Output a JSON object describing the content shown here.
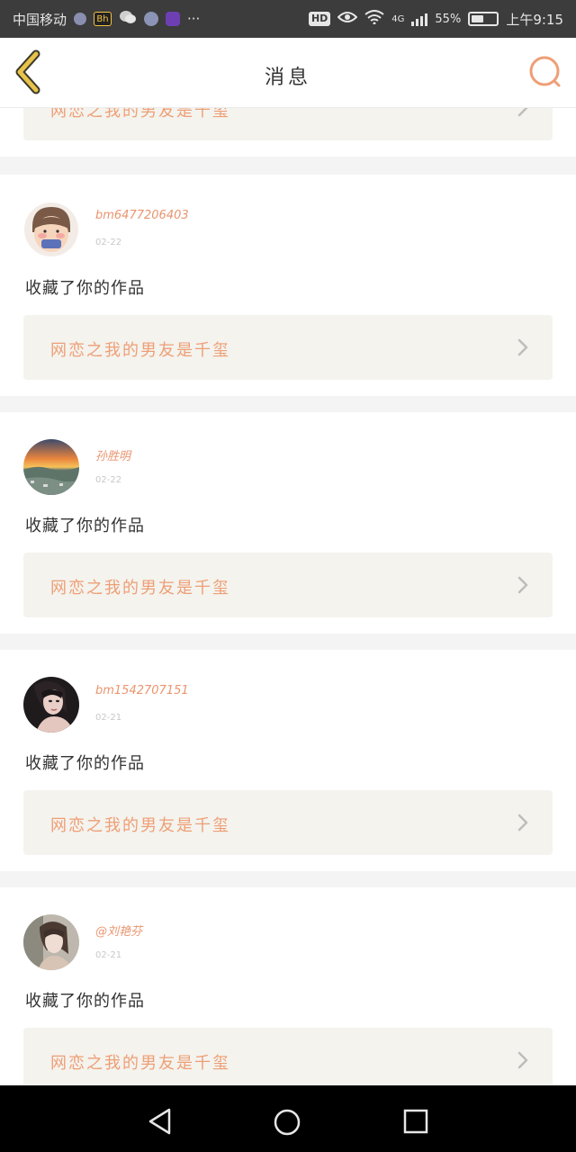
{
  "status_bar": {
    "carrier": "中国移动",
    "network": "4G",
    "hd_label": "HD",
    "battery_percent": "55%",
    "battery_level": 0.55,
    "time": "上午9:15",
    "more": "···"
  },
  "header": {
    "title": "消息"
  },
  "colors": {
    "accent": "#ee9f76",
    "username": "#e9956f",
    "card_link_bg": "#f4f3ee"
  },
  "top_partial": {
    "work_title": "网恋之我的男友是千玺"
  },
  "messages": [
    {
      "username": "bm6477206403",
      "date": "02-22",
      "action": "收藏了你的作品",
      "work_title": "网恋之我的男友是千玺",
      "avatar": "cartoon-face-avatar"
    },
    {
      "username": "孙胜明",
      "date": "02-22",
      "action": "收藏了你的作品",
      "work_title": "网恋之我的男友是千玺",
      "avatar": "sunset-landscape-avatar"
    },
    {
      "username": "bm1542707151",
      "date": "02-21",
      "action": "收藏了你的作品",
      "work_title": "网恋之我的男友是千玺",
      "avatar": "woman-portrait-avatar"
    },
    {
      "username": "@刘艳芬",
      "date": "02-21",
      "action": "收藏了你的作品",
      "work_title": "网恋之我的男友是千玺",
      "avatar": "girl-photo-avatar"
    }
  ]
}
